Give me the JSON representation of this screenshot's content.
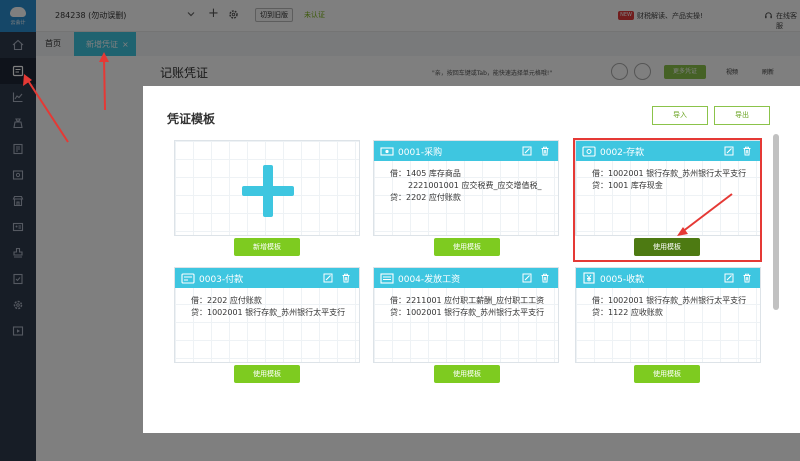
{
  "sidebar": {
    "logo_text": "云会计",
    "items": [
      {
        "icon": "home-icon",
        "active": false
      },
      {
        "icon": "voucher-icon",
        "active": true
      },
      {
        "icon": "chart-icon",
        "active": false
      },
      {
        "icon": "money-bag-icon",
        "active": false
      },
      {
        "icon": "ledger-icon",
        "active": false
      },
      {
        "icon": "receipt-icon",
        "active": false
      },
      {
        "icon": "store-icon",
        "active": false
      },
      {
        "icon": "id-card-icon",
        "active": false
      },
      {
        "icon": "stamp-icon",
        "active": false
      },
      {
        "icon": "document-check-icon",
        "active": false
      },
      {
        "icon": "settings-icon",
        "active": false
      },
      {
        "icon": "play-icon",
        "active": false
      }
    ]
  },
  "header": {
    "company": "284238 (勿动误删)",
    "switch_label": "切到旧版",
    "unverified": "未认证",
    "news_badge": "NEW",
    "news_text": "财税解读、产品实操!",
    "service_text": "在线客服"
  },
  "tabs": {
    "home": "首页",
    "active": "新增凭证",
    "close": "×"
  },
  "page": {
    "title": "记账凭证",
    "hint": "\"亲，按回车键或Tab，能快速选择单元格哦!\"",
    "more": "更多凭证",
    "video": "视频",
    "refresh": "刷新"
  },
  "modal": {
    "title": "凭证模板",
    "import": "导入",
    "export": "导出",
    "close": "×",
    "add_label": "新增模板",
    "use_label": "使用模板",
    "templates": [
      {
        "name": "0001-采购",
        "icon": "money-icon",
        "lines": [
          "借：1405 库存商品",
          "2221001001 应交税费_应交增值税_",
          "贷：2202 应付账款"
        ]
      },
      {
        "name": "0002-存款",
        "icon": "deposit-icon",
        "lines": [
          "借：1002001 银行存款_苏州银行太平支行",
          "贷：1001 库存现金"
        ]
      },
      {
        "name": "0003-付款",
        "icon": "payment-icon",
        "lines": [
          "借：2202 应付账款",
          "贷：1002001 银行存款_苏州银行太平支行"
        ]
      },
      {
        "name": "0004-发放工资",
        "icon": "payroll-icon",
        "lines": [
          "借：2211001 应付职工薪酬_应付职工工资",
          "贷：1002001 银行存款_苏州银行太平支行"
        ]
      },
      {
        "name": "0005-收款",
        "icon": "yen-icon",
        "lines": [
          "借：1002001 银行存款_苏州银行太平支行",
          "贷：1122 应收账款"
        ]
      }
    ]
  },
  "colors": {
    "accent": "#3ec6e0",
    "button_green": "#7ecb20",
    "button_green_hover": "#4d7a12",
    "sidebar": "#2f3a4d",
    "annotation_red": "#e53935"
  }
}
